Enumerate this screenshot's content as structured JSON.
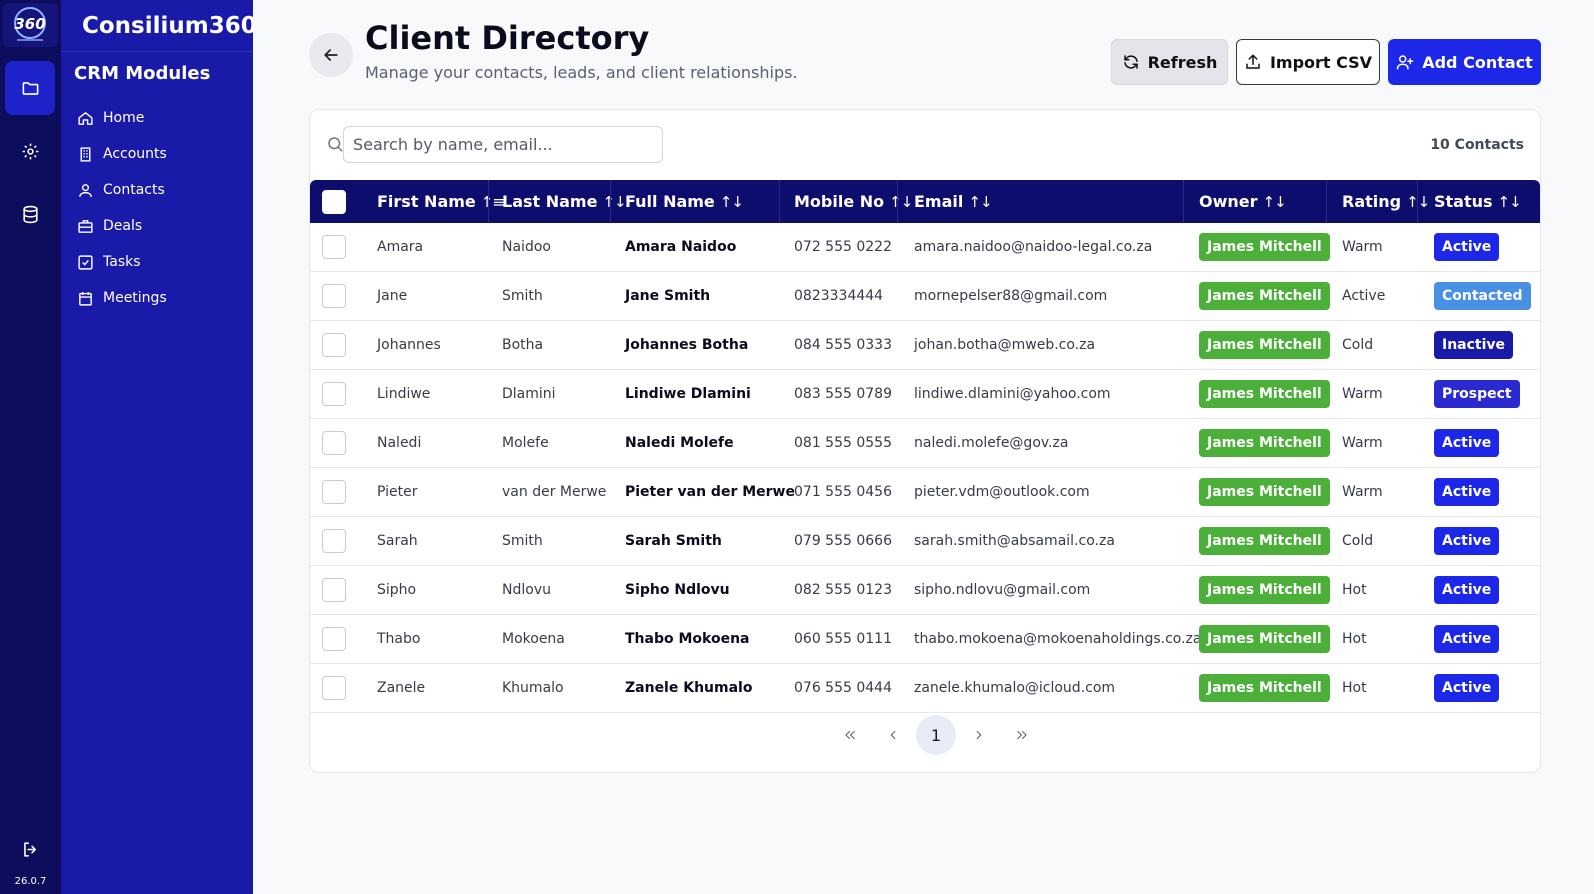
{
  "app": {
    "brand": "Consilium360",
    "version": "26.0.7"
  },
  "sidebar": {
    "title": "CRM Modules",
    "items": [
      {
        "label": "Home",
        "icon": "home-icon"
      },
      {
        "label": "Accounts",
        "icon": "building-icon"
      },
      {
        "label": "Contacts",
        "icon": "user-icon"
      },
      {
        "label": "Deals",
        "icon": "briefcase-icon"
      },
      {
        "label": "Tasks",
        "icon": "checkbox-icon"
      },
      {
        "label": "Meetings",
        "icon": "calendar-icon"
      }
    ]
  },
  "header": {
    "title": "Client Directory",
    "subtitle": "Manage your contacts, leads, and client relationships.",
    "refresh_label": "Refresh",
    "import_label": "Import CSV",
    "add_label": "Add Contact"
  },
  "search": {
    "placeholder": "Search by name, email...",
    "value": ""
  },
  "contact_count": "10 Contacts",
  "columns": [
    "First Name",
    "Last Name",
    "Full Name",
    "Mobile No",
    "Email",
    "Owner",
    "Rating",
    "Status"
  ],
  "rows": [
    {
      "first": "Amara",
      "last": "Naidoo",
      "full": "Amara Naidoo",
      "mobile": "072 555 0222",
      "email": "amara.naidoo@naidoo-legal.co.za",
      "owner": "James Mitchell",
      "rating": "Warm",
      "status": "Active"
    },
    {
      "first": "Jane",
      "last": "Smith",
      "full": "Jane Smith",
      "mobile": "0823334444",
      "email": "mornepelser88@gmail.com",
      "owner": "James Mitchell",
      "rating": "Active",
      "status": "Contacted"
    },
    {
      "first": "Johannes",
      "last": "Botha",
      "full": "Johannes Botha",
      "mobile": "084 555 0333",
      "email": "johan.botha@mweb.co.za",
      "owner": "James Mitchell",
      "rating": "Cold",
      "status": "Inactive"
    },
    {
      "first": "Lindiwe",
      "last": "Dlamini",
      "full": "Lindiwe Dlamini",
      "mobile": "083 555 0789",
      "email": "lindiwe.dlamini@yahoo.com",
      "owner": "James Mitchell",
      "rating": "Warm",
      "status": "Prospect"
    },
    {
      "first": "Naledi",
      "last": "Molefe",
      "full": "Naledi Molefe",
      "mobile": "081 555 0555",
      "email": "naledi.molefe@gov.za",
      "owner": "James Mitchell",
      "rating": "Warm",
      "status": "Active"
    },
    {
      "first": "Pieter",
      "last": "van der Merwe",
      "full": "Pieter van der Merwe",
      "mobile": "071 555 0456",
      "email": "pieter.vdm@outlook.com",
      "owner": "James Mitchell",
      "rating": "Warm",
      "status": "Active"
    },
    {
      "first": "Sarah",
      "last": "Smith",
      "full": "Sarah Smith",
      "mobile": "079 555 0666",
      "email": "sarah.smith@absamail.co.za",
      "owner": "James Mitchell",
      "rating": "Cold",
      "status": "Active"
    },
    {
      "first": "Sipho",
      "last": "Ndlovu",
      "full": "Sipho Ndlovu",
      "mobile": "082 555 0123",
      "email": "sipho.ndlovu@gmail.com",
      "owner": "James Mitchell",
      "rating": "Hot",
      "status": "Active"
    },
    {
      "first": "Thabo",
      "last": "Mokoena",
      "full": "Thabo Mokoena",
      "mobile": "060 555 0111",
      "email": "thabo.mokoena@mokoenaholdings.co.za",
      "owner": "James Mitchell",
      "rating": "Hot",
      "status": "Active"
    },
    {
      "first": "Zanele",
      "last": "Khumalo",
      "full": "Zanele Khumalo",
      "mobile": "076 555 0444",
      "email": "zanele.khumalo@icloud.com",
      "owner": "James Mitchell",
      "rating": "Hot",
      "status": "Active"
    }
  ],
  "status_colors": {
    "Active": "#1d27e8",
    "Contacted": "#4a90e2",
    "Inactive": "#1a1aa8",
    "Prospect": "#2a2ad0"
  },
  "owner_color": "#4caf3a",
  "pagination": {
    "current_page": "1"
  },
  "colors": {
    "rail": "#0d0d5e",
    "sidebar": "#1a1aa8",
    "table_header": "#0d0d6e",
    "primary": "#1d27e8"
  }
}
